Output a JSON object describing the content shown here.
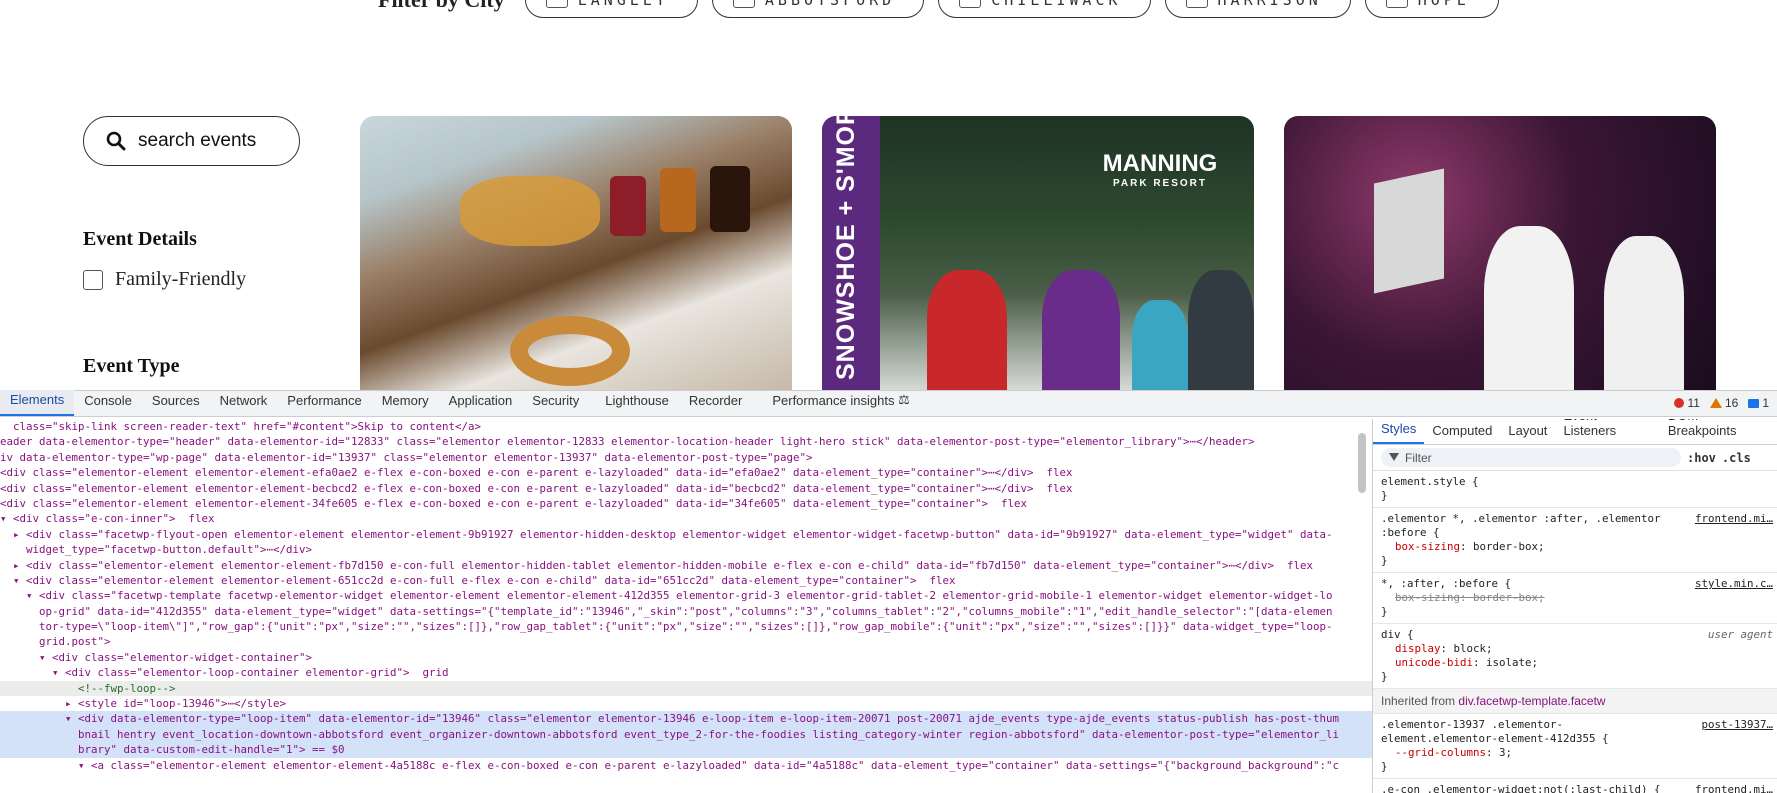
{
  "site": {
    "filter_label": "Filter by City",
    "cities": [
      "LANGLEY",
      "ABBOTSFORD",
      "CHILLIWACK",
      "HARRISON",
      "HOPE"
    ],
    "search_placeholder": "search events",
    "event_details_heading": "Event Details",
    "family_friendly_label": "Family-Friendly",
    "event_type_heading": "Event Type",
    "card2_band_text": "SNOWSHOE + S'MORES",
    "card2_brand_line1": "MANNING",
    "card2_brand_line2": "PARK RESORT"
  },
  "devtools": {
    "tabs": [
      "Elements",
      "Console",
      "Sources",
      "Network",
      "Performance",
      "Memory",
      "Application",
      "Security",
      "Lighthouse",
      "Recorder",
      "Performance insights"
    ],
    "active_tab": "Elements",
    "errors": "11",
    "warnings": "16",
    "infos": "1",
    "styles_tabs": [
      "Styles",
      "Computed",
      "Layout",
      "Event Listeners",
      "DOM Breakpoints"
    ],
    "filter_placeholder": "Filter",
    "hov_label": ":hov",
    "cls_label": ".cls",
    "dom_lines": [
      "  class=\"skip-link screen-reader-text\" href=\"#content\">Skip to content</a>",
      "eader data-elementor-type=\"header\" data-elementor-id=\"12833\" class=\"elementor elementor-12833 elementor-location-header light-hero stick\" data-elementor-post-type=\"elementor_library\">⋯</header>",
      "iv data-elementor-type=\"wp-page\" data-elementor-id=\"13937\" class=\"elementor elementor-13937\" data-elementor-post-type=\"page\">",
      "<div class=\"elementor-element elementor-element-efa0ae2 e-flex e-con-boxed e-con e-parent e-lazyloaded\" data-id=\"efa0ae2\" data-element_type=\"container\">⋯</div>  flex",
      "<div class=\"elementor-element elementor-element-becbcd2 e-flex e-con-boxed e-con e-parent e-lazyloaded\" data-id=\"becbcd2\" data-element_type=\"container\">⋯</div>  flex",
      "<div class=\"elementor-element elementor-element-34fe605 e-flex e-con-boxed e-con e-parent e-lazyloaded\" data-id=\"34fe605\" data-element_type=\"container\">  flex",
      "▾ <div class=\"e-con-inner\">  flex",
      "  ▸ <div class=\"facetwp-flyout-open elementor-element elementor-element-9b91927 elementor-hidden-desktop elementor-widget elementor-widget-facetwp-button\" data-id=\"9b91927\" data-element_type=\"widget\" data-",
      "    widget_type=\"facetwp-button.default\">⋯</div>",
      "  ▸ <div class=\"elementor-element elementor-element-fb7d150 e-con-full elementor-hidden-tablet elementor-hidden-mobile e-flex e-con e-child\" data-id=\"fb7d150\" data-element_type=\"container\">⋯</div>  flex",
      "  ▾ <div class=\"elementor-element elementor-element-651cc2d e-con-full e-flex e-con e-child\" data-id=\"651cc2d\" data-element_type=\"container\">  flex",
      "    ▾ <div class=\"facetwp-template facetwp-elementor-widget elementor-element elementor-element-412d355 elementor-grid-3 elementor-grid-tablet-2 elementor-grid-mobile-1 elementor-widget elementor-widget-lo",
      "      op-grid\" data-id=\"412d355\" data-element_type=\"widget\" data-settings=\"{\"template_id\":\"13946\",\"_skin\":\"post\",\"columns\":\"3\",\"columns_tablet\":\"2\",\"columns_mobile\":\"1\",\"edit_handle_selector\":\"[data-elemen",
      "      tor-type=\\\"loop-item\\\"]\",\"row_gap\":{\"unit\":\"px\",\"size\":\"\",\"sizes\":[]},\"row_gap_tablet\":{\"unit\":\"px\",\"size\":\"\",\"sizes\":[]},\"row_gap_mobile\":{\"unit\":\"px\",\"size\":\"\",\"sizes\":[]}}\" data-widget_type=\"loop-",
      "      grid.post\">",
      "      ▾ <div class=\"elementor-widget-container\">",
      "        ▾ <div class=\"elementor-loop-container elementor-grid\">  grid",
      "            <!--fwp-loop-->",
      "          ▸ <style id=\"loop-13946\">⋯</style>",
      "          ▾ <div data-elementor-type=\"loop-item\" data-elementor-id=\"13946\" class=\"elementor elementor-13946 e-loop-item e-loop-item-20071 post-20071 ajde_events type-ajde_events status-publish has-post-thum",
      "            bnail hentry event_location-downtown-abbotsford event_organizer-downtown-abbotsford event_type_2-for-the-foodies listing_category-winter region-abbotsford\" data-elementor-post-type=\"elementor_li",
      "            brary\" data-custom-edit-handle=\"1\"> == $0",
      "            ▾ <a class=\"elementor-element elementor-element-4a5188c e-flex e-con-boxed e-con e-parent e-lazyloaded\" data-id=\"4a5188c\" data-element_type=\"container\" data-settings=\"{\"background_background\":\"c"
    ],
    "styles": [
      {
        "selector": "element.style {",
        "props": [],
        "close": "}",
        "src": ""
      },
      {
        "selector": ".elementor *, .elementor :after, .elementor :before {",
        "props": [
          {
            "name": "box-sizing",
            "value": "border-box;",
            "struck": false
          }
        ],
        "close": "}",
        "src": "frontend.mi…"
      },
      {
        "selector": "*, :after, :before {",
        "props": [
          {
            "name": "box-sizing",
            "value": "border-box;",
            "struck": true
          }
        ],
        "close": "}",
        "src": "style.min.c…"
      },
      {
        "selector": "div {",
        "props": [
          {
            "name": "display",
            "value": "block;",
            "struck": false
          },
          {
            "name": "unicode-bidi",
            "value": "isolate;",
            "struck": false
          }
        ],
        "close": "}",
        "src": "user agent"
      }
    ],
    "inherited_label": "Inherited from",
    "inherited_from": "div.facetwp-template.facetw",
    "styles2": [
      {
        "selector": ".elementor-13937 .elementor-element.elementor-element-412d355 {",
        "props": [
          {
            "name": "--grid-columns",
            "value": "3;",
            "struck": false
          }
        ],
        "close": "}",
        "src": "post-13937…"
      },
      {
        "selector": ".e-con .elementor-widget:not(:last-child) {",
        "props": [],
        "close": "",
        "src": "frontend.mi…"
      }
    ]
  }
}
